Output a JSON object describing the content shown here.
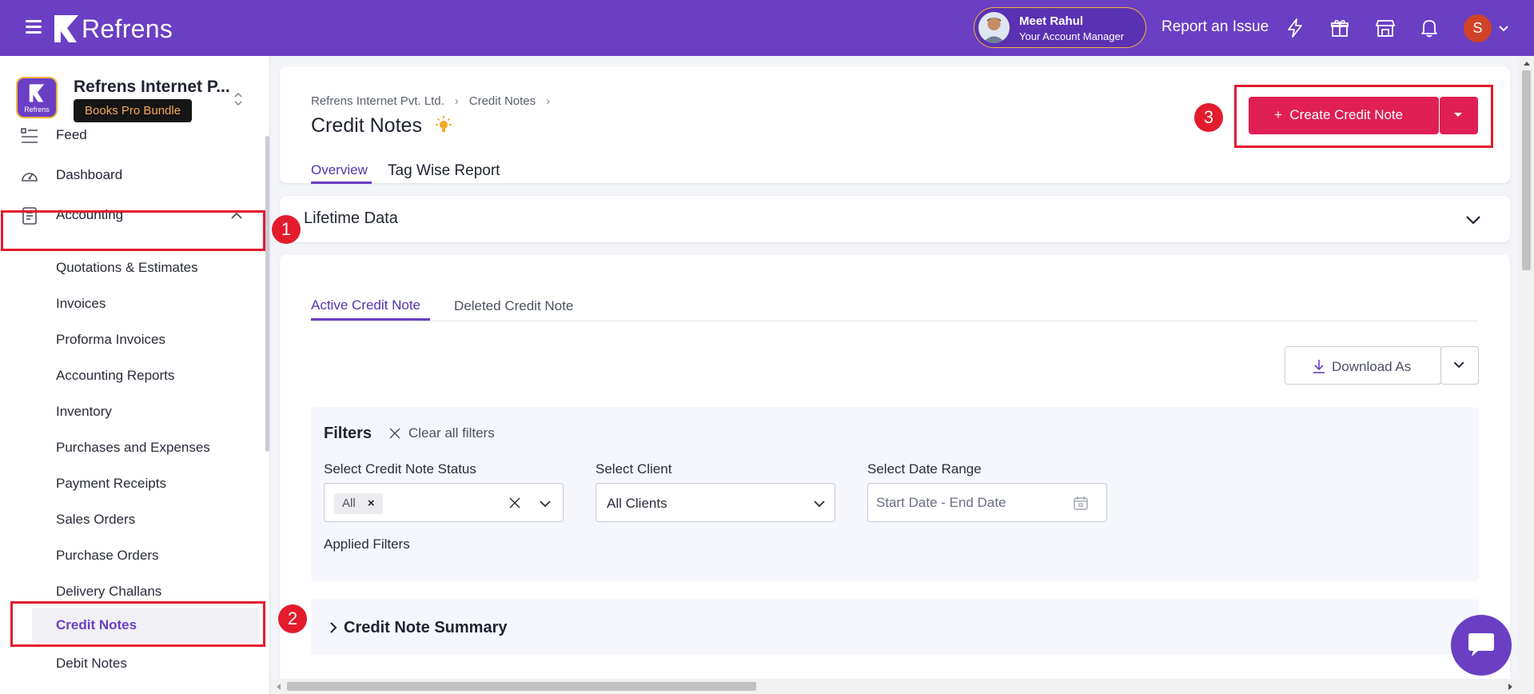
{
  "topbar": {
    "brand": "Refrens",
    "manager_name": "Meet Rahul",
    "manager_role": "Your Account Manager",
    "report_issue": "Report an Issue",
    "user_initial": "S",
    "bg_color": "#6a3fc4"
  },
  "sidebar": {
    "org_name": "Refrens Internet P...",
    "org_logo_text": "Refrens",
    "org_badge": "Books Pro Bundle",
    "nav": {
      "feed": "Feed",
      "dashboard": "Dashboard",
      "accounting": "Accounting"
    },
    "accounting_items": [
      "Quotations & Estimates",
      "Invoices",
      "Proforma Invoices",
      "Accounting Reports",
      "Inventory",
      "Purchases and Expenses",
      "Payment Receipts",
      "Sales Orders",
      "Purchase Orders",
      "Delivery Challans",
      "Credit Notes",
      "Debit Notes"
    ]
  },
  "header": {
    "breadcrumb": [
      "Refrens Internet Pvt. Ltd.",
      "Credit Notes"
    ],
    "title": "Credit Notes",
    "tabs": [
      "Overview",
      "Tag Wise Report"
    ],
    "create_button": "Create Credit Note"
  },
  "lifetime": {
    "title": "Lifetime Data"
  },
  "main": {
    "tabs": [
      "Active Credit Note",
      "Deleted Credit Note"
    ],
    "download_button": "Download As"
  },
  "filters": {
    "title": "Filters",
    "clear_all": "Clear all filters",
    "status_label": "Select Credit Note Status",
    "status_chip": "All",
    "client_label": "Select Client",
    "client_value": "All Clients",
    "date_label": "Select Date Range",
    "date_placeholder": "Start Date - End Date",
    "applied": "Applied Filters"
  },
  "summary": {
    "title": "Credit Note Summary"
  },
  "annotations": {
    "step1": "1",
    "step2": "2",
    "step3": "3",
    "highlight_color": "#e31b2d"
  },
  "colors": {
    "accent": "#6a3fc4",
    "cta": "#e01f55"
  }
}
